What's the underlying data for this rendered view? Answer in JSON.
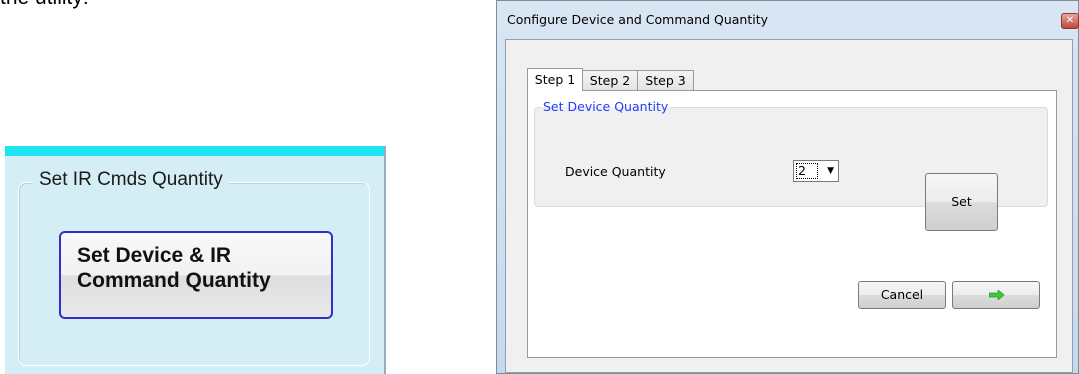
{
  "left_snippet": {
    "top_text": "the utility:",
    "group_title": "Set IR Cmds Quantity",
    "button_line1": "Set Device & IR",
    "button_line2": "Command Quantity"
  },
  "dialog": {
    "title": "Configure Device and Command Quantity",
    "tabs": [
      {
        "label": "Step 1",
        "active": true
      },
      {
        "label": "Step 2",
        "active": false
      },
      {
        "label": "Step 3",
        "active": false
      }
    ],
    "device_group": {
      "title": "Set Device Quantity",
      "field_label": "Device Quantity",
      "selected_value": "2",
      "set_button": "Set"
    },
    "cancel_button": "Cancel",
    "next_button_icon": "right-arrow-icon"
  },
  "colors": {
    "accent_cyan": "#1ee4f2",
    "panel_bg": "#d5edf4",
    "button_border_blue": "#3030c8",
    "group_title_blue": "#1e3cff",
    "arrow_green": "#3cc83c"
  }
}
